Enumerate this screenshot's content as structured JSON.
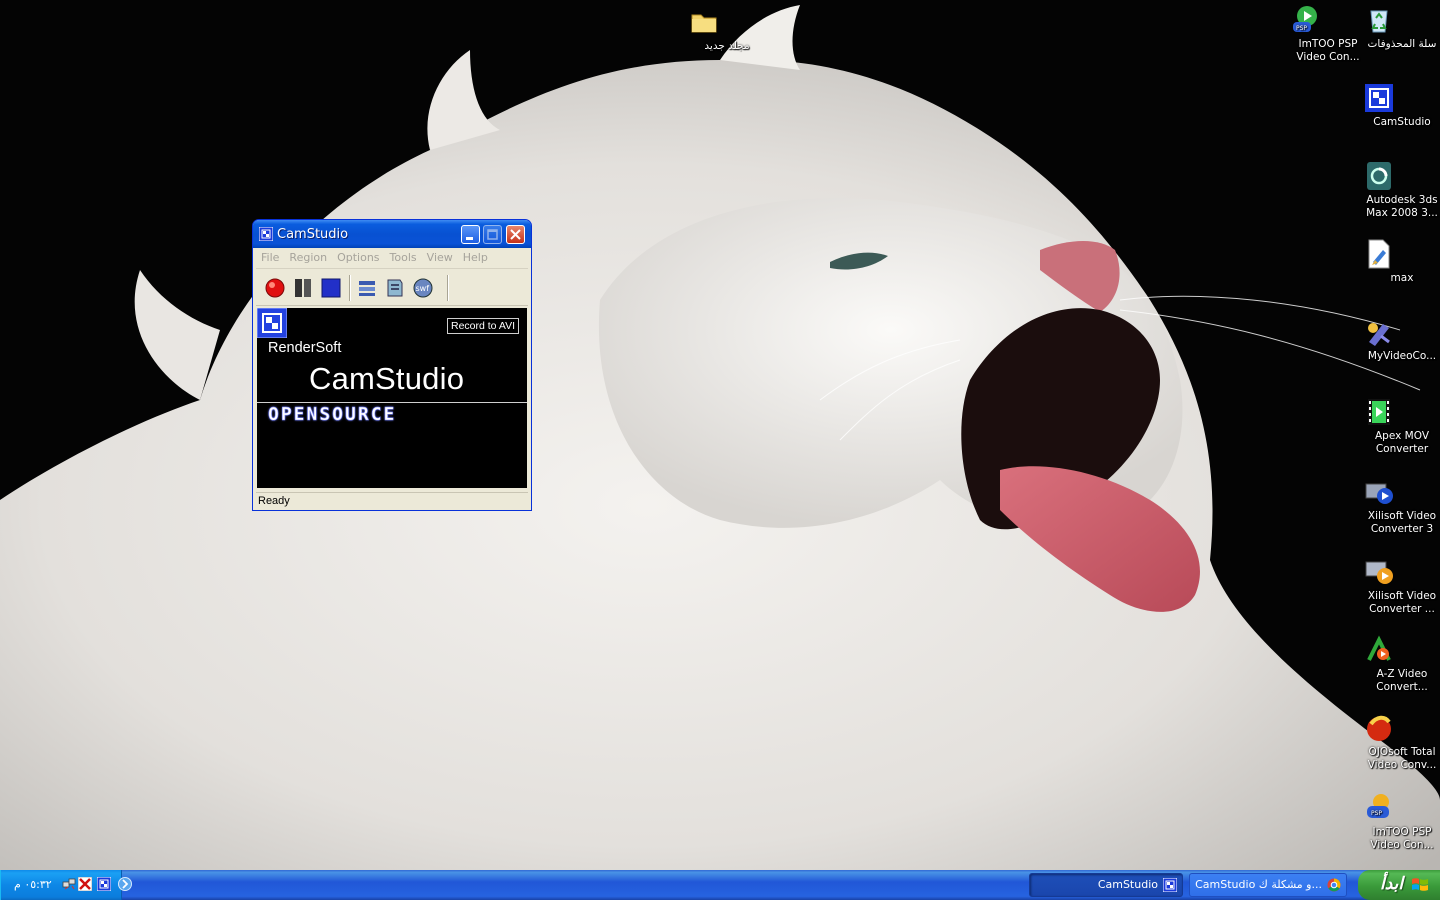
{
  "desktop": {
    "icons": [
      {
        "id": "new-folder",
        "label": "مجلد جديد",
        "icon": "folder-icon"
      },
      {
        "id": "imtoo-psp-top",
        "label": "ImTOO PSP Video Con...",
        "icon": "psp-video-icon"
      },
      {
        "id": "recycle-bin",
        "label": "سلة المحذوفات",
        "icon": "recycle-bin-icon"
      },
      {
        "id": "camstudio",
        "label": "CamStudio",
        "icon": "camstudio-icon"
      },
      {
        "id": "autodesk-3ds",
        "label": "Autodesk 3ds Max 2008 3...",
        "icon": "3dsmax-icon"
      },
      {
        "id": "max",
        "label": "max",
        "icon": "max-file-icon"
      },
      {
        "id": "myvideoco",
        "label": "MyVideoCo...",
        "icon": "video-converter-icon"
      },
      {
        "id": "apex-mov",
        "label": "Apex MOV Converter",
        "icon": "film-icon"
      },
      {
        "id": "xilisoft-3",
        "label": "Xilisoft Video Converter 3",
        "icon": "xilisoft-icon"
      },
      {
        "id": "xilisoft",
        "label": "Xilisoft Video Converter ...",
        "icon": "xilisoft-play-icon"
      },
      {
        "id": "az-video",
        "label": "A-Z Video Convert...",
        "icon": "az-video-icon"
      },
      {
        "id": "ojosoft",
        "label": "OJOsoft Total Video Conv...",
        "icon": "ojosoft-icon"
      },
      {
        "id": "imtoo-psp-bottom",
        "label": "ImTOO PSP Video Con...",
        "icon": "psp-video-icon"
      }
    ]
  },
  "camstudio": {
    "title": "CamStudio",
    "menu": [
      "File",
      "Region",
      "Options",
      "Tools",
      "View",
      "Help"
    ],
    "toolbar": [
      {
        "id": "record",
        "icon": "record-icon"
      },
      {
        "id": "pause",
        "icon": "pause-icon"
      },
      {
        "id": "stop",
        "icon": "stop-icon"
      },
      {
        "id": "region",
        "icon": "region-icon"
      },
      {
        "id": "annotate",
        "icon": "annotate-icon"
      },
      {
        "id": "swf",
        "icon": "swf-icon",
        "label": "swf"
      }
    ],
    "screen": {
      "mode_label": "Record to AVI",
      "vendor": "RenderSoft",
      "product": "CamStudio",
      "edition": "OPENSOURCE"
    },
    "status": "Ready"
  },
  "taskbar": {
    "start_label": "ابدأ",
    "buttons": [
      {
        "id": "browser",
        "label": "CamStudio و مشكلة ك...",
        "icon": "chrome-icon",
        "active": false
      },
      {
        "id": "camstudio",
        "label": "CamStudio",
        "icon": "camstudio-icon",
        "active": true
      }
    ],
    "clock": "٠٥:٣٢ م",
    "tray_icons": [
      "network-icon",
      "antivirus-icon",
      "camstudio-tray-icon"
    ]
  },
  "colors": {
    "taskbar": "#245edb",
    "start": "#3c9b3c",
    "title": "#0a5ddf",
    "window_bg": "#ece9d8"
  }
}
